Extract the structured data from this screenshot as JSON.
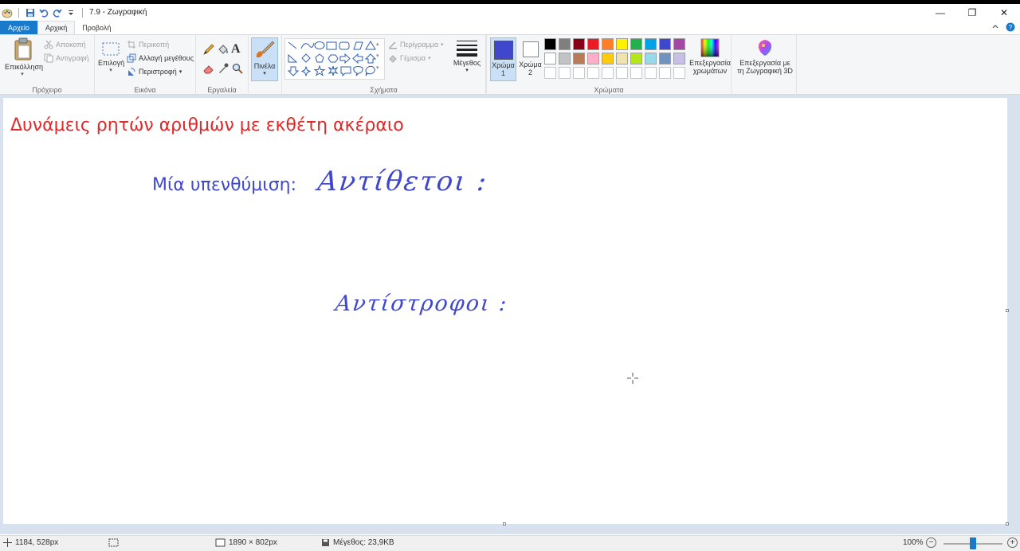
{
  "window": {
    "title": "7.9 - Ζωγραφική",
    "controls": {
      "minimize": "—",
      "maximize": "❐",
      "close": "✕"
    }
  },
  "tabs": {
    "file": "Αρχείο",
    "home": "Αρχική",
    "view": "Προβολή"
  },
  "ribbon": {
    "clipboard": {
      "paste": "Επικόλληση",
      "cut": "Αποκοπή",
      "copy": "Αντιγραφή",
      "label": "Πρόχειρο"
    },
    "image": {
      "select": "Επιλογή",
      "crop": "Περικοπή",
      "resize": "Αλλαγή μεγέθους",
      "rotate": "Περιστροφή",
      "label": "Εικόνα"
    },
    "tools": {
      "label": "Εργαλεία",
      "text_glyph": "A"
    },
    "brushes": {
      "label": "Πινέλα"
    },
    "shapes": {
      "outline": "Περίγραμμα",
      "fill": "Γέμισμα",
      "label": "Σχήματα"
    },
    "size": {
      "label": "Μέγεθος"
    },
    "colors": {
      "color1_line1": "Χρώμα",
      "color1_line2": "1",
      "color2_line1": "Χρώμα",
      "color2_line2": "2",
      "edit_line1": "Επεξεργασία",
      "edit_line2": "χρωμάτων",
      "paint3d_line1": "Επεξεργασία με",
      "paint3d_line2": "τη Ζωγραφική 3D",
      "label": "Χρώματα",
      "color1_value": "#3f48cc",
      "color2_value": "#ffffff",
      "palette_row1": [
        "#000000",
        "#7f7f7f",
        "#880015",
        "#ed1c24",
        "#ff7f27",
        "#fff200",
        "#22b14c",
        "#00a2e8",
        "#3f48cc",
        "#a349a4"
      ],
      "palette_row2": [
        "#ffffff",
        "#c3c3c3",
        "#b97a57",
        "#ffaec9",
        "#ffc90e",
        "#efe4b0",
        "#b5e61d",
        "#99d9ea",
        "#7092be",
        "#c8bfe7"
      ],
      "palette_row3": [
        "#ffffff",
        "#ffffff",
        "#ffffff",
        "#ffffff",
        "#ffffff",
        "#ffffff",
        "#ffffff",
        "#ffffff",
        "#ffffff",
        "#ffffff"
      ]
    }
  },
  "canvas": {
    "heading": "Δυνάμεις ρητών αριθμών με εκθέτη ακέραιο",
    "reminder": "Μία υπενθύμιση:",
    "handwriting1": "Αντίθετοι :",
    "handwriting2": "Αντίστροφοι :",
    "heading_color": "#e02828",
    "ink_color": "#3f48cc"
  },
  "status": {
    "cursor_pos": "1184, 528px",
    "canvas_size": "1890 × 802px",
    "file_size": "Μέγεθος: 23,9KB",
    "zoom": "100%",
    "zoom_minus": "−",
    "zoom_plus": "+",
    "zoom_level": 0.5
  }
}
